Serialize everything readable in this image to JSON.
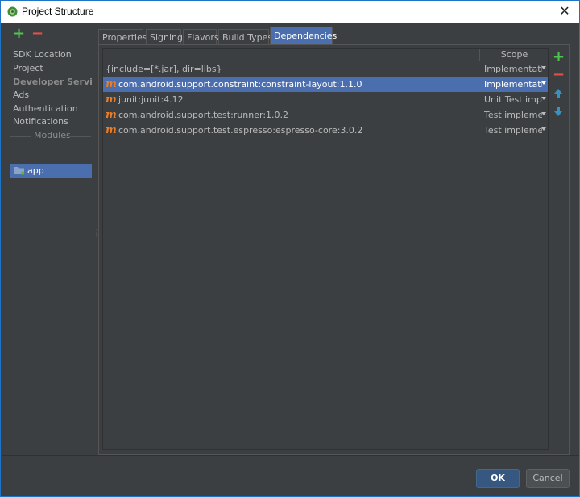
{
  "window": {
    "title": "Project Structure",
    "close_label": "✕"
  },
  "toolbar": {
    "add": "+",
    "remove": "−"
  },
  "sidebar": {
    "items": [
      {
        "label": "SDK Location"
      },
      {
        "label": "Project"
      }
    ],
    "developer_services_header": "Developer Services",
    "services": [
      {
        "label": "Ads"
      },
      {
        "label": "Authentication"
      },
      {
        "label": "Notifications"
      }
    ],
    "modules_header": "Modules",
    "modules": [
      {
        "label": "app",
        "selected": true
      }
    ]
  },
  "tabs": [
    {
      "label": "Properties",
      "active": false
    },
    {
      "label": "Signing",
      "active": false
    },
    {
      "label": "Flavors",
      "active": false
    },
    {
      "label": "Build Types",
      "active": false
    },
    {
      "label": "Dependencies",
      "active": true
    }
  ],
  "table": {
    "headers": {
      "name": "",
      "scope": "Scope"
    },
    "rows": [
      {
        "icon": "",
        "name": "{include=[*.jar], dir=libs}",
        "scope": "Implementation",
        "selected": false
      },
      {
        "icon": "m",
        "name": "com.android.support.constraint:constraint-layout:1.1.0",
        "scope": "Implementation",
        "selected": true
      },
      {
        "icon": "m",
        "name": "junit:junit:4.12",
        "scope": "Unit Test impl.",
        "selected": false
      },
      {
        "icon": "m",
        "name": "com.android.support.test:runner:1.0.2",
        "scope": "Test implemen",
        "selected": false
      },
      {
        "icon": "m",
        "name": "com.android.support.test.espresso:espresso-core:3.0.2",
        "scope": "Test implemen",
        "selected": false
      }
    ]
  },
  "side_tools": {
    "add": "+",
    "remove": "−"
  },
  "buttons": {
    "ok": "OK",
    "cancel": "Cancel"
  },
  "colors": {
    "accent": "#4b6eaf",
    "background": "#3c3f41",
    "maven_icon": "#e87e2a",
    "add": "#4fc24f",
    "remove": "#e2504a",
    "arrows": "#3592c4"
  }
}
